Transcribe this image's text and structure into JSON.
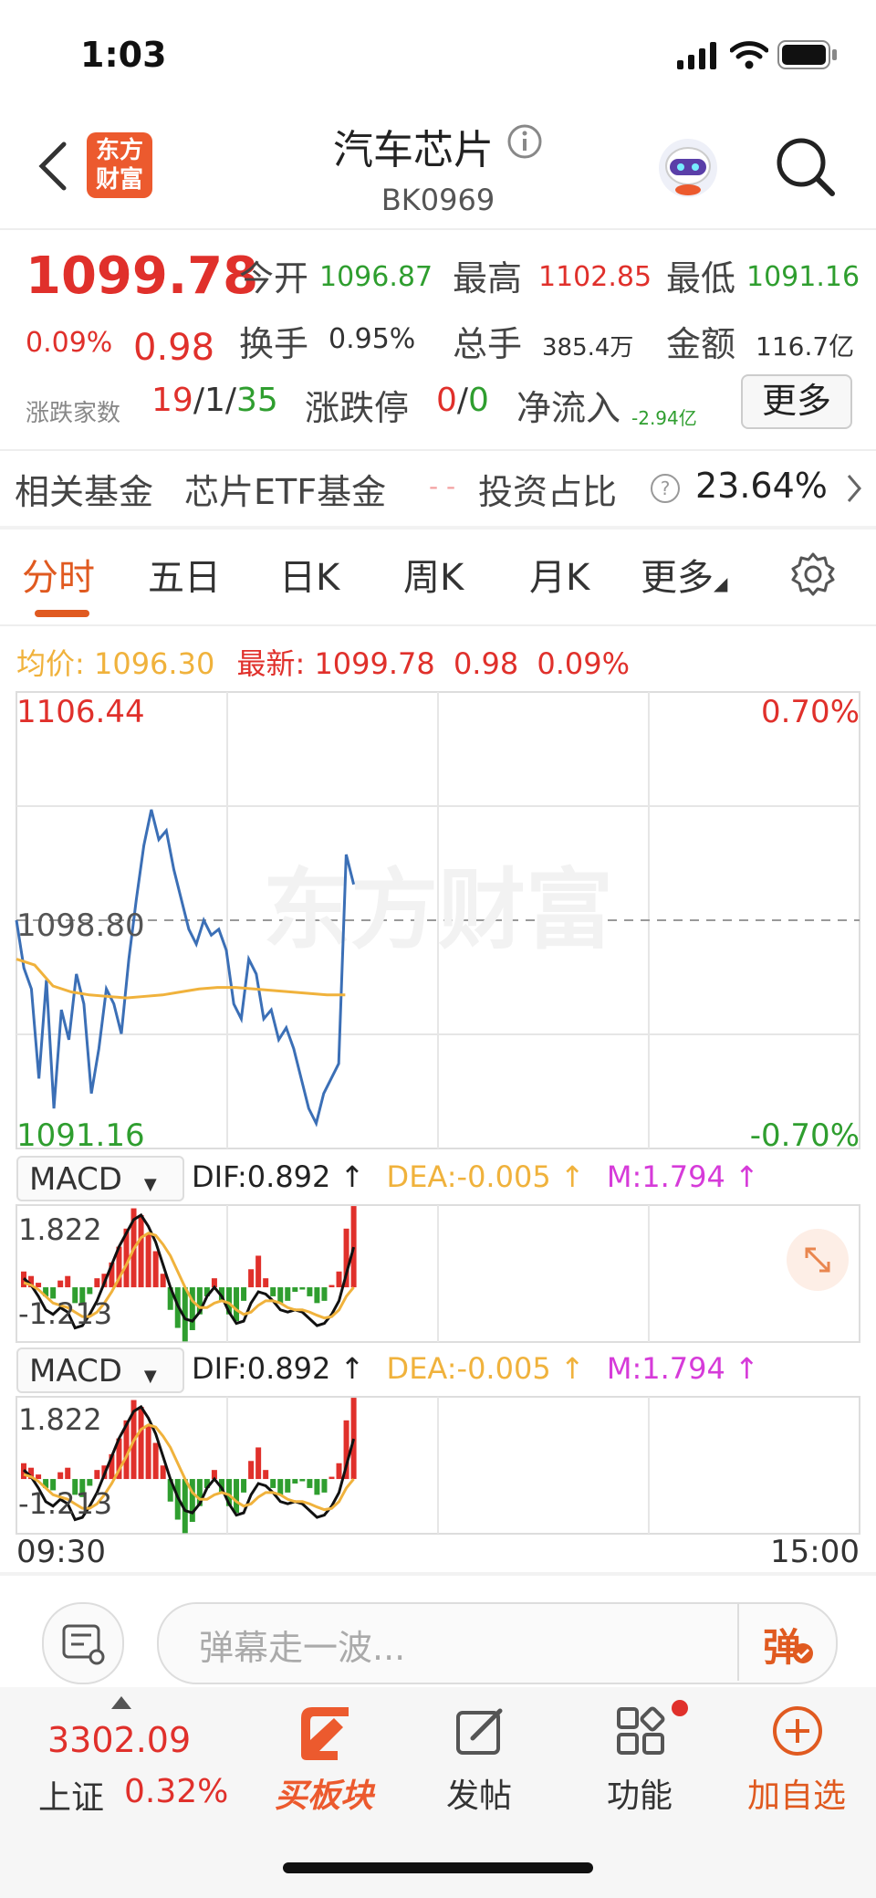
{
  "status": {
    "time": "1:03"
  },
  "header": {
    "logo_line1": "东方",
    "logo_line2": "财富",
    "title": "汽车芯片",
    "code": "BK0969"
  },
  "quote": {
    "price": "1099.78",
    "change_pct": "0.09%",
    "change": "0.98",
    "open_label": "今开",
    "open": "1096.87",
    "high_label": "最高",
    "high": "1102.85",
    "low_label": "最低",
    "low": "1091.16",
    "turnover_label": "换手",
    "turnover": "0.95%",
    "volume_label": "总手",
    "volume": "385.4万",
    "amount_label": "金额",
    "amount": "116.7亿",
    "breadth_label": "涨跌家数",
    "up": "19",
    "sep1": "/",
    "flat": "1",
    "sep2": "/",
    "down": "35",
    "limit_label": "涨跌停",
    "limit_up": "0",
    "sep3": "/",
    "limit_down": "0",
    "inflow_label": "净流入",
    "inflow": "-2.94亿",
    "more": "更多"
  },
  "fund": {
    "label": "相关基金",
    "name": "芯片ETF基金",
    "dash": "- -",
    "ratio_label": "投资占比",
    "ratio": "23.64%"
  },
  "tabs": [
    {
      "label": "分时",
      "active": true
    },
    {
      "label": "五日"
    },
    {
      "label": "日K"
    },
    {
      "label": "周K"
    },
    {
      "label": "月K"
    },
    {
      "label": "更多"
    }
  ],
  "chart_header": {
    "avg_label": "均价:",
    "avg": "1096.30",
    "last_label": "最新:",
    "last": "1099.78",
    "chg": "0.98",
    "pct": "0.09%"
  },
  "chart_data": {
    "type": "line",
    "price_axis": {
      "top": "1106.44",
      "mid": "1098.80",
      "bottom": "1091.16"
    },
    "pct_axis": {
      "top": "0.70%",
      "bottom": "-0.70%"
    },
    "ylim": [
      1091.16,
      1106.44
    ],
    "prev_close": 1098.8,
    "x_start": "09:30",
    "x_end": "15:00",
    "price": [
      1098.8,
      1097.2,
      1096.5,
      1093.5,
      1096.8,
      1092.5,
      1095.8,
      1094.8,
      1097.0,
      1096.0,
      1093.0,
      1094.5,
      1096.5,
      1096.0,
      1095.0,
      1097.5,
      1099.5,
      1101.3,
      1102.5,
      1101.5,
      1101.8,
      1100.5,
      1099.5,
      1098.5,
      1098.0,
      1098.8,
      1098.3,
      1098.5,
      1097.8,
      1096.0,
      1095.5,
      1097.5,
      1097.0,
      1095.5,
      1095.8,
      1094.8,
      1095.2,
      1094.5,
      1093.5,
      1092.5,
      1092.0,
      1093.0,
      1093.5,
      1094.0,
      1101.0,
      1100.0
    ],
    "avg": [
      1097.5,
      1097.3,
      1096.6,
      1096.4,
      1096.3,
      1096.25,
      1096.2,
      1096.25,
      1096.3,
      1096.4,
      1096.5,
      1096.55,
      1096.55,
      1096.5,
      1096.45,
      1096.4,
      1096.35,
      1096.3,
      1096.3
    ],
    "macd_header": {
      "name": "MACD",
      "dif": "DIF:0.892",
      "dea": "DEA:-0.005",
      "m": "M:1.794",
      "arrow": "↑"
    },
    "macd_axis": {
      "top": "1.822",
      "bottom": "-1.213"
    },
    "macd_ylim": [
      -1.213,
      1.822
    ],
    "macd_hist": [
      0.35,
      0.25,
      0.1,
      -0.2,
      -0.25,
      0.15,
      0.25,
      -0.35,
      -0.4,
      -0.15,
      0.2,
      0.3,
      0.55,
      0.9,
      1.3,
      1.75,
      1.6,
      1.2,
      0.8,
      0.3,
      -0.5,
      -0.9,
      -1.2,
      -0.95,
      -0.6,
      -0.2,
      0.2,
      -0.3,
      -0.6,
      -0.75,
      -0.3,
      0.4,
      0.7,
      0.2,
      -0.2,
      -0.35,
      -0.3,
      -0.1,
      -0.05,
      -0.2,
      -0.35,
      -0.3,
      0.05,
      0.35,
      1.3,
      1.8
    ],
    "macd_dif": [
      0.2,
      0.05,
      -0.2,
      -0.5,
      -0.6,
      -0.45,
      -0.55,
      -0.9,
      -0.85,
      -0.6,
      -0.3,
      0.1,
      0.5,
      0.9,
      1.2,
      1.5,
      1.6,
      1.35,
      1.0,
      0.5,
      0.0,
      -0.4,
      -0.7,
      -0.75,
      -0.55,
      -0.2,
      0.0,
      -0.2,
      -0.55,
      -0.8,
      -0.75,
      -0.35,
      -0.1,
      -0.15,
      -0.3,
      -0.5,
      -0.55,
      -0.5,
      -0.55,
      -0.7,
      -0.85,
      -0.8,
      -0.6,
      -0.3,
      0.3,
      0.89
    ],
    "macd_dea": [
      0.1,
      0.05,
      -0.05,
      -0.2,
      -0.35,
      -0.4,
      -0.45,
      -0.55,
      -0.65,
      -0.65,
      -0.55,
      -0.35,
      -0.1,
      0.2,
      0.5,
      0.85,
      1.1,
      1.2,
      1.15,
      0.95,
      0.7,
      0.35,
      0.0,
      -0.3,
      -0.45,
      -0.45,
      -0.35,
      -0.3,
      -0.35,
      -0.5,
      -0.6,
      -0.55,
      -0.4,
      -0.3,
      -0.3,
      -0.35,
      -0.45,
      -0.5,
      -0.5,
      -0.55,
      -0.62,
      -0.68,
      -0.65,
      -0.5,
      -0.2,
      0.0
    ]
  },
  "bottom": {
    "danmu_placeholder": "弹幕走一波...",
    "danmu_btn": "弹",
    "index_value": "3302.09",
    "index_name": "上证",
    "index_pct": "0.32%",
    "nav": [
      {
        "label": "买板块"
      },
      {
        "label": "发帖"
      },
      {
        "label": "功能"
      },
      {
        "label": "加自选"
      }
    ]
  },
  "colors": {
    "up": "#e0302b",
    "down": "#2f9e2f",
    "accent": "#e05a20",
    "price_line": "#3b6fb6",
    "avg_line": "#f0b23c",
    "m_color": "#d63bd9"
  }
}
